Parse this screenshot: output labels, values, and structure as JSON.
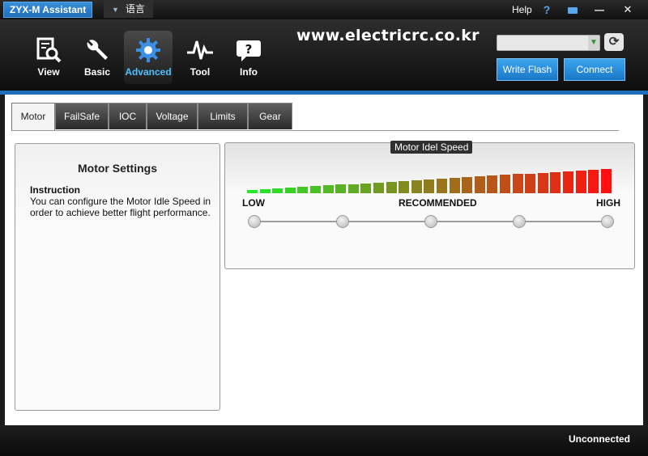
{
  "window": {
    "title": "ZYX-M Assistant",
    "language_label": "语言",
    "help_label": "Help",
    "help_icon": "?",
    "minimize_glyph": "—",
    "close_glyph": "✕"
  },
  "toolbar": {
    "nav": [
      {
        "label": "View",
        "icon": "magnifier-document-icon"
      },
      {
        "label": "Basic",
        "icon": "wrench-icon"
      },
      {
        "label": "Advanced",
        "icon": "gear-icon",
        "active": true
      },
      {
        "label": "Tool",
        "icon": "pulse-icon"
      },
      {
        "label": "Info",
        "icon": "question-bubble-icon"
      }
    ],
    "site_text": "www.electricrc.co.kr",
    "port_value": "",
    "refresh_glyph": "⟳",
    "write_flash_label": "Write Flash",
    "connect_label": "Connect"
  },
  "tabs": [
    "Motor",
    "FailSafe",
    "IOC",
    "Voltage",
    "Limits",
    "Gear"
  ],
  "active_tab": "Motor",
  "motor_settings": {
    "title": "Motor Settings",
    "instruction_title": "Instruction",
    "instruction_text": "You can configure the Motor Idle Speed in order to achieve better flight performance."
  },
  "idle_speed": {
    "group_title": "Motor Idel Speed",
    "low_label": "LOW",
    "recommended_label": "RECOMMENDED",
    "high_label": "HIGH",
    "stop_count": 5,
    "bar_count": 29,
    "colors": {
      "low": "#22e82a",
      "high": "#ff1010"
    }
  },
  "status": {
    "connection": "Unconnected"
  }
}
